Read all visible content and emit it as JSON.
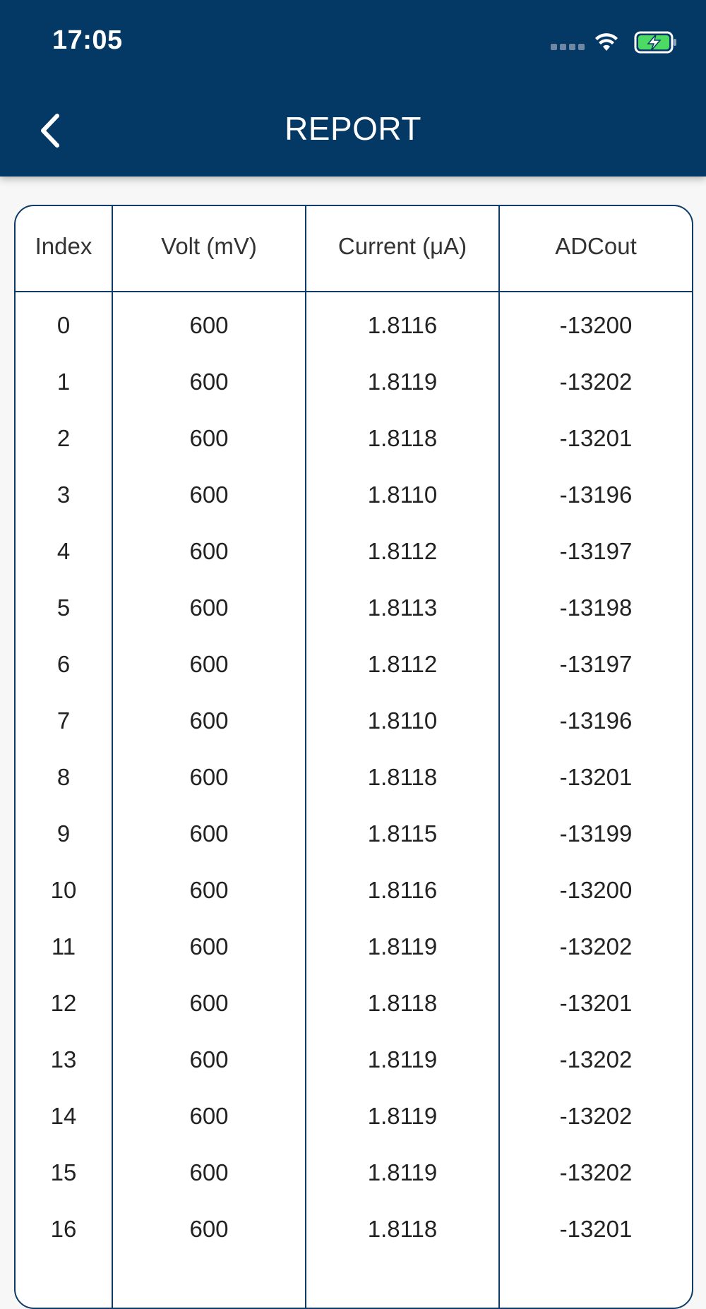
{
  "status_bar": {
    "time": "17:05",
    "icons": [
      "signal-icon",
      "wifi-icon",
      "battery-charging-icon"
    ]
  },
  "nav": {
    "title": "REPORT",
    "back_icon": "chevron-left-icon"
  },
  "colors": {
    "header_bg": "#043865",
    "table_border": "#0f3b68",
    "battery_green": "#4cd964"
  },
  "table": {
    "columns": [
      "Index",
      "Volt (mV)",
      "Current (μA)",
      "ADCout"
    ],
    "rows": [
      [
        "0",
        "600",
        "1.8116",
        "-13200"
      ],
      [
        "1",
        "600",
        "1.8119",
        "-13202"
      ],
      [
        "2",
        "600",
        "1.8118",
        "-13201"
      ],
      [
        "3",
        "600",
        "1.8110",
        "-13196"
      ],
      [
        "4",
        "600",
        "1.8112",
        "-13197"
      ],
      [
        "5",
        "600",
        "1.8113",
        "-13198"
      ],
      [
        "6",
        "600",
        "1.8112",
        "-13197"
      ],
      [
        "7",
        "600",
        "1.8110",
        "-13196"
      ],
      [
        "8",
        "600",
        "1.8118",
        "-13201"
      ],
      [
        "9",
        "600",
        "1.8115",
        "-13199"
      ],
      [
        "10",
        "600",
        "1.8116",
        "-13200"
      ],
      [
        "11",
        "600",
        "1.8119",
        "-13202"
      ],
      [
        "12",
        "600",
        "1.8118",
        "-13201"
      ],
      [
        "13",
        "600",
        "1.8119",
        "-13202"
      ],
      [
        "14",
        "600",
        "1.8119",
        "-13202"
      ],
      [
        "15",
        "600",
        "1.8119",
        "-13202"
      ],
      [
        "16",
        "600",
        "1.8118",
        "-13201"
      ]
    ]
  }
}
